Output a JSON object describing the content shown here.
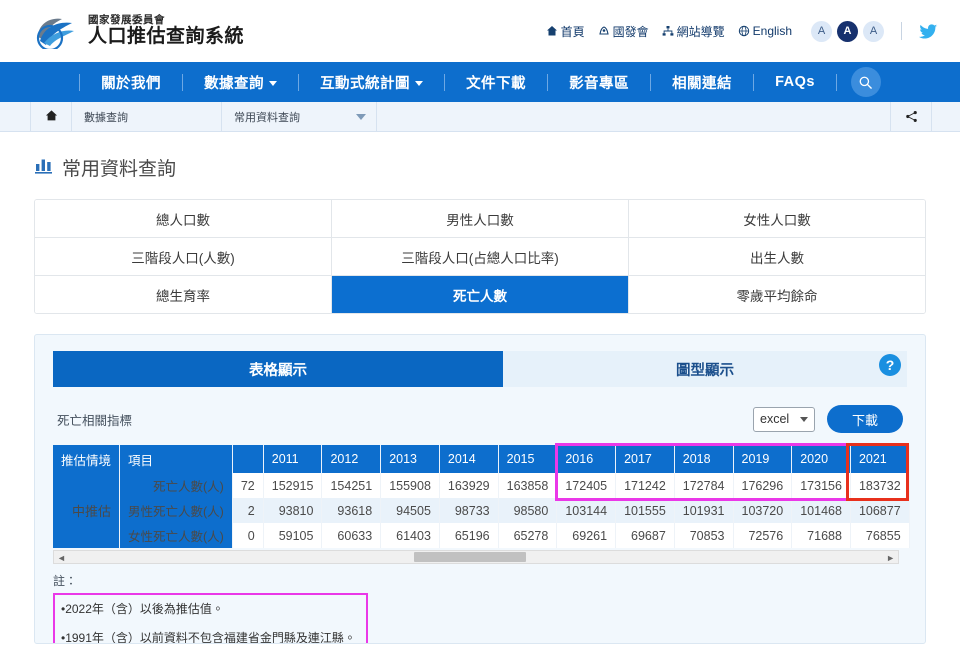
{
  "header": {
    "brand_sub": "國家發展委員會",
    "brand_main": "人口推估查詢系統",
    "toplinks": [
      {
        "label": "首頁",
        "icon": "home-icon"
      },
      {
        "label": "國發會",
        "icon": "org-icon"
      },
      {
        "label": "網站導覽",
        "icon": "sitemap-icon"
      },
      {
        "label": "English",
        "icon": "globe-icon"
      }
    ],
    "font_sizes": [
      {
        "label": "A",
        "active": false
      },
      {
        "label": "A",
        "active": true
      },
      {
        "label": "A",
        "active": false
      }
    ],
    "social": "twitter-icon"
  },
  "nav": {
    "items": [
      {
        "label": "關於我們",
        "has_caret": false
      },
      {
        "label": "數據查詢",
        "has_caret": true
      },
      {
        "label": "互動式統計圖",
        "has_caret": true
      },
      {
        "label": "文件下載",
        "has_caret": false
      },
      {
        "label": "影音專區",
        "has_caret": false
      },
      {
        "label": "相關連結",
        "has_caret": false
      },
      {
        "label": "FAQs",
        "has_caret": false
      }
    ],
    "search_icon": "search-icon"
  },
  "breadcrumb": {
    "home_icon": "home-icon",
    "level1": "數據查詢",
    "level2_selected": "常用資料查詢",
    "share_icon": "share-icon"
  },
  "page": {
    "title": "常用資料查詢",
    "title_icon": "bar-chart-icon"
  },
  "categories": [
    [
      {
        "label": "總人口數",
        "active": false
      },
      {
        "label": "男性人口數",
        "active": false
      },
      {
        "label": "女性人口數",
        "active": false
      }
    ],
    [
      {
        "label": "三階段人口(人數)",
        "active": false
      },
      {
        "label": "三階段人口(占總人口比率)",
        "active": false
      },
      {
        "label": "出生人數",
        "active": false
      }
    ],
    [
      {
        "label": "總生育率",
        "active": false
      },
      {
        "label": "死亡人數",
        "active": true
      },
      {
        "label": "零歲平均餘命",
        "active": false
      }
    ]
  ],
  "panel": {
    "tabs": [
      {
        "label": "表格顯示",
        "active": true
      },
      {
        "label": "圖型顯示",
        "active": false
      }
    ],
    "help_icon": "question-mark-icon",
    "toolbar": {
      "label": "死亡相關指標",
      "format_selected": "excel",
      "format_options": [
        "excel"
      ],
      "download_label": "下載"
    }
  },
  "table": {
    "headers": {
      "scenario": "推估情境",
      "item": "項目",
      "partial_year": "",
      "years": [
        "2011",
        "2012",
        "2013",
        "2014",
        "2015",
        "2016",
        "2017",
        "2018",
        "2019",
        "2020",
        "2021"
      ]
    },
    "scenario_label": "中推估",
    "rows": [
      {
        "item": "死亡人數(人)",
        "partial": "72",
        "values": [
          "152915",
          "154251",
          "155908",
          "163929",
          "163858",
          "172405",
          "171242",
          "172784",
          "176296",
          "173156",
          "183732"
        ]
      },
      {
        "item": "男性死亡人數(人)",
        "partial": "2",
        "values": [
          "93810",
          "93618",
          "94505",
          "98733",
          "98580",
          "103144",
          "101555",
          "101931",
          "103720",
          "101468",
          "106877"
        ]
      },
      {
        "item": "女性死亡人數(人)",
        "partial": "0",
        "values": [
          "59105",
          "60633",
          "61403",
          "65196",
          "65278",
          "69261",
          "69687",
          "70853",
          "72576",
          "71688",
          "76855"
        ]
      }
    ]
  },
  "annotations": [
    {
      "name": "magenta-box-years-2016-2020",
      "color": "#ea38e8"
    },
    {
      "name": "red-box-year-2021",
      "color": "#e8301c"
    },
    {
      "name": "magenta-box-notes",
      "color": "#ea38e8"
    }
  ],
  "notes": {
    "title": "註：",
    "lines": [
      "•2022年（含）以後為推估值。",
      "•1991年（含）以前資料不包含福建省金門縣及連江縣。"
    ]
  }
}
